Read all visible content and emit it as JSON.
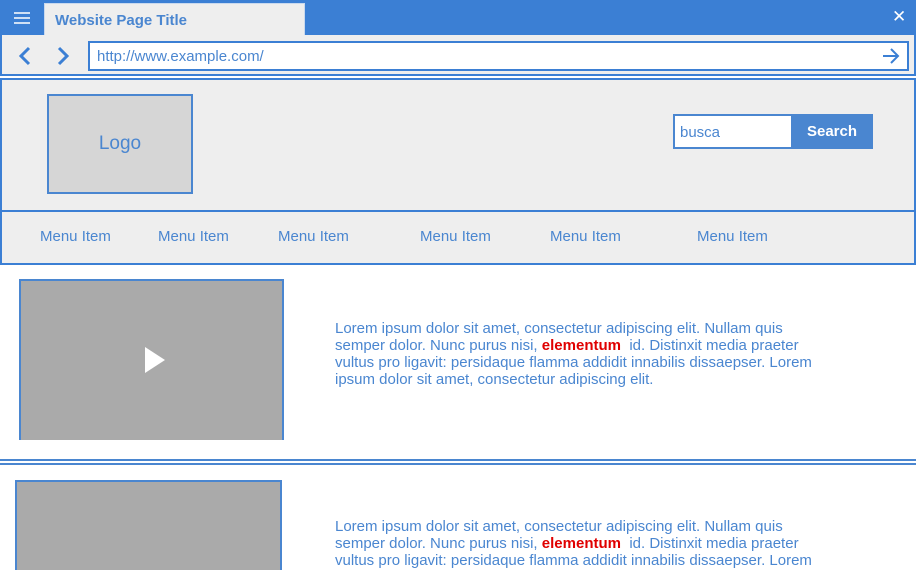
{
  "window": {
    "tab_title": "Website Page Title",
    "close_glyph": "✕",
    "menu_icon": "hamburger-icon"
  },
  "navbar": {
    "url": "http://www.example.com/",
    "back_icon": "chevron-left-icon",
    "forward_icon": "chevron-right-icon",
    "go_icon": "arrow-right-icon"
  },
  "header": {
    "logo_label": "Logo",
    "search_value": "busca",
    "search_button_label": "Search"
  },
  "menu": {
    "items": [
      "Menu Item",
      "Menu Item",
      "Menu Item",
      "Menu Item",
      "Menu Item",
      "Menu Item"
    ]
  },
  "content": {
    "rows": [
      {
        "text_before": "Lorem ipsum dolor sit amet, consectetur adipiscing elit. Nullam quis semper dolor. Nunc purus nisi,",
        "highlight": "elementum",
        "text_after": "id. Distinxit  media praeter vultus pro ligavit: persidaque flamma addidit innabilis dissaepser. Lorem ipsum dolor sit amet, consectetur adipiscing elit."
      },
      {
        "text_before": "Lorem ipsum dolor sit amet, consectetur adipiscing elit. Nullam quis semper dolor. Nunc purus nisi,",
        "highlight": "elementum",
        "text_after": "id. Distinxit  media praeter vultus pro ligavit: persidaque flamma addidit innabilis dissaepser. Lorem"
      }
    ]
  },
  "colors": {
    "accent": "#3b7fd4",
    "text": "#4a86d0",
    "highlight": "#e00000",
    "video_placeholder": "#aaaaaa"
  }
}
